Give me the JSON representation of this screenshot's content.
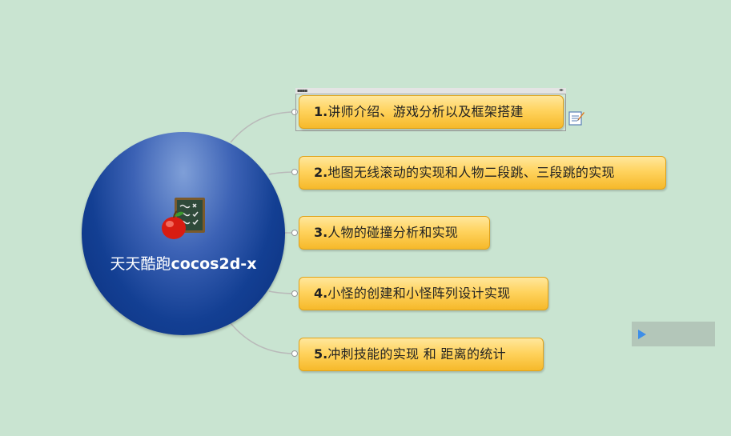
{
  "root": {
    "label_cn": "天天酷跑",
    "label_lat": "cocos2d-x",
    "icon": "apple-chalkboard-icon"
  },
  "topics": [
    {
      "num": "1.",
      "text": "讲师介绍、游戏分析以及框架搭建",
      "selected": true,
      "has_note": true
    },
    {
      "num": "2.",
      "text": "地图无线滚动的实现和人物二段跳、三段跳的实现"
    },
    {
      "num": "3.",
      "text": "人物的碰撞分析和实现"
    },
    {
      "num": "4.",
      "text": "小怪的创建和小怪阵列设计实现"
    },
    {
      "num": "5.",
      "text": "冲刺技能的实现 和 距离的统计"
    }
  ],
  "icons": {
    "note": "note-icon",
    "play": "play-icon"
  },
  "colors": {
    "background": "#c9e4d1",
    "root_fill": "#133f93",
    "topic_fill": "#ffd35e",
    "connector": "#b9b9b9",
    "play": "#3d8ee8"
  }
}
